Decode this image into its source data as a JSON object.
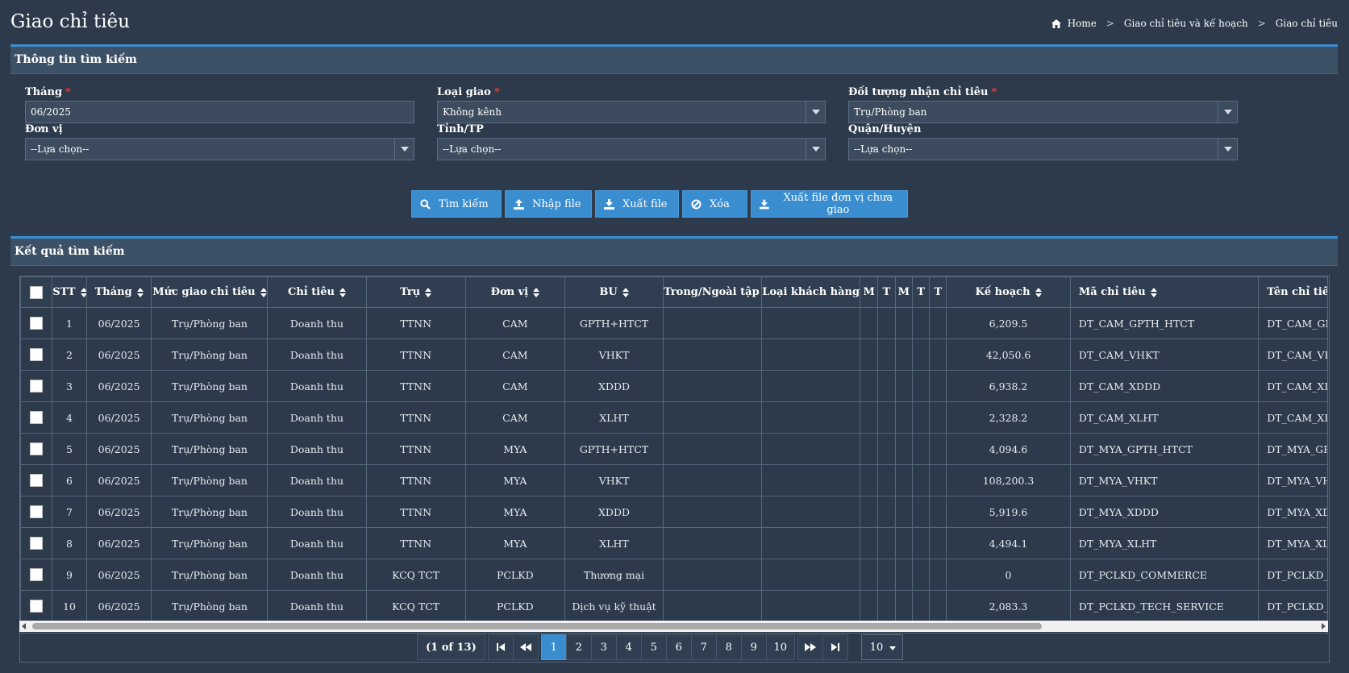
{
  "page": {
    "title": "Giao chỉ tiêu",
    "breadcrumb": [
      "Home",
      "Giao chỉ tiêu và kế hoạch",
      "Giao chỉ tiêu"
    ]
  },
  "search": {
    "panel_title": "Thông tin tìm kiếm",
    "fields": {
      "thang": {
        "label": "Tháng",
        "value": "06/2025"
      },
      "loai_giao": {
        "label": "Loại giao",
        "value": "Không kênh"
      },
      "doi_tuong": {
        "label": "Đối tượng nhận chỉ tiêu",
        "value": "Trụ/Phòng ban"
      },
      "don_vi": {
        "label": "Đơn vị",
        "value": "--Lựa chọn--"
      },
      "tinh_tp": {
        "label": "Tỉnh/TP",
        "value": "--Lựa chọn--"
      },
      "quan_huyen": {
        "label": "Quận/Huyện",
        "value": "--Lựa chọn--"
      }
    },
    "buttons": {
      "search": "Tìm kiếm",
      "import": "Nhập file",
      "export": "Xuất file",
      "clear": "Xóa",
      "export_unassigned": "Xuất file đơn vị chưa giao"
    }
  },
  "results": {
    "panel_title": "Kết quả tìm kiếm",
    "columns": [
      "STT",
      "Tháng",
      "Mức giao chỉ tiêu",
      "Chỉ tiêu",
      "Trụ",
      "Đơn vị",
      "BU",
      "Trong/Ngoài tập đ",
      "Loại khách hàng",
      "M",
      "T",
      "M",
      "T",
      "T",
      "Kế hoạch",
      "Mã chỉ tiêu",
      "Tên chỉ tiêu"
    ],
    "rows": [
      [
        "1",
        "06/2025",
        "Trụ/Phòng ban",
        "Doanh thu",
        "TTNN",
        "CAM",
        "GPTH+HTCT",
        "",
        "",
        "",
        "",
        "",
        "",
        "",
        "6,209.5",
        "DT_CAM_GPTH_HTCT",
        "DT_CAM_GPTH_HTCT"
      ],
      [
        "2",
        "06/2025",
        "Trụ/Phòng ban",
        "Doanh thu",
        "TTNN",
        "CAM",
        "VHKT",
        "",
        "",
        "",
        "",
        "",
        "",
        "",
        "42,050.6",
        "DT_CAM_VHKT",
        "DT_CAM_VHKT"
      ],
      [
        "3",
        "06/2025",
        "Trụ/Phòng ban",
        "Doanh thu",
        "TTNN",
        "CAM",
        "XDDD",
        "",
        "",
        "",
        "",
        "",
        "",
        "",
        "6,938.2",
        "DT_CAM_XDDD",
        "DT_CAM_XDDD"
      ],
      [
        "4",
        "06/2025",
        "Trụ/Phòng ban",
        "Doanh thu",
        "TTNN",
        "CAM",
        "XLHT",
        "",
        "",
        "",
        "",
        "",
        "",
        "",
        "2,328.2",
        "DT_CAM_XLHT",
        "DT_CAM_XLHT"
      ],
      [
        "5",
        "06/2025",
        "Trụ/Phòng ban",
        "Doanh thu",
        "TTNN",
        "MYA",
        "GPTH+HTCT",
        "",
        "",
        "",
        "",
        "",
        "",
        "",
        "4,094.6",
        "DT_MYA_GPTH_HTCT",
        "DT_MYA_GPTH_HTCT"
      ],
      [
        "6",
        "06/2025",
        "Trụ/Phòng ban",
        "Doanh thu",
        "TTNN",
        "MYA",
        "VHKT",
        "",
        "",
        "",
        "",
        "",
        "",
        "",
        "108,200.3",
        "DT_MYA_VHKT",
        "DT_MYA_VHKT"
      ],
      [
        "7",
        "06/2025",
        "Trụ/Phòng ban",
        "Doanh thu",
        "TTNN",
        "MYA",
        "XDDD",
        "",
        "",
        "",
        "",
        "",
        "",
        "",
        "5,919.6",
        "DT_MYA_XDDD",
        "DT_MYA_XDDD"
      ],
      [
        "8",
        "06/2025",
        "Trụ/Phòng ban",
        "Doanh thu",
        "TTNN",
        "MYA",
        "XLHT",
        "",
        "",
        "",
        "",
        "",
        "",
        "",
        "4,494.1",
        "DT_MYA_XLHT",
        "DT_MYA_XLHT"
      ],
      [
        "9",
        "06/2025",
        "Trụ/Phòng ban",
        "Doanh thu",
        "KCQ TCT",
        "PCLKD",
        "Thương mại",
        "",
        "",
        "",
        "",
        "",
        "",
        "",
        "0",
        "DT_PCLKD_COMMERCE",
        "DT_PCLKD_COMMERCE"
      ],
      [
        "10",
        "06/2025",
        "Trụ/Phòng ban",
        "Doanh thu",
        "KCQ TCT",
        "PCLKD",
        "Dịch vụ kỹ thuật",
        "",
        "",
        "",
        "",
        "",
        "",
        "",
        "2,083.3",
        "DT_PCLKD_TECH_SERVICE",
        "DT_PCLKD_TECH_SERVICE"
      ]
    ]
  },
  "pagination": {
    "info": "(1 of 13)",
    "pages": [
      "1",
      "2",
      "3",
      "4",
      "5",
      "6",
      "7",
      "8",
      "9",
      "10"
    ],
    "current": "1",
    "page_size": "10"
  },
  "colors": {
    "accent": "#3a8ed0",
    "background": "#2c3a4b",
    "required": "#e04040"
  }
}
